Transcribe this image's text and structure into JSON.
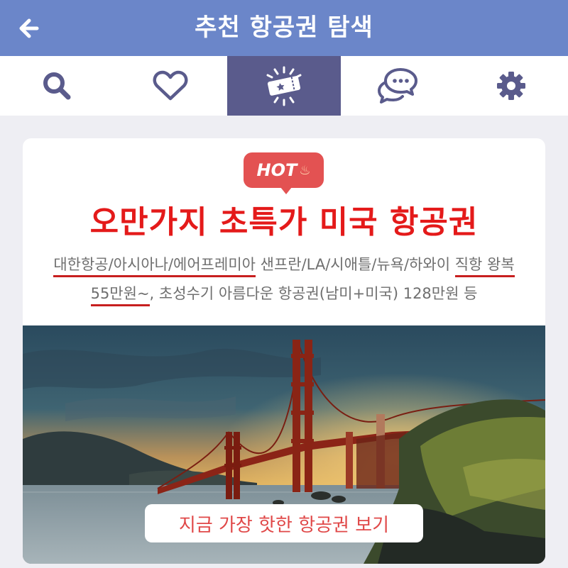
{
  "header": {
    "title": "추천 항공권 탐색",
    "back_icon": "arrow-left-icon"
  },
  "tabs": [
    {
      "icon": "search-icon",
      "active": false
    },
    {
      "icon": "heart-icon",
      "active": false
    },
    {
      "icon": "ticket-icon",
      "active": true
    },
    {
      "icon": "chat-icon",
      "active": false
    },
    {
      "icon": "gear-icon",
      "active": false
    }
  ],
  "card": {
    "badge": "HOT",
    "headline": "오만가지 초특가 미국 항공권",
    "line1": {
      "airlines": "대한항공/아시아나/에어프레미아",
      "cities": " 샌프란/LA/시애틀/뉴욕/하와이 ",
      "direct": "직항 왕복"
    },
    "line2": {
      "price": "55만원~",
      "rest": ", 초성수기 아름다운 항공권(남미+미국) 128만원 등"
    },
    "cta": "지금 가장 핫한 항공권 보기"
  },
  "colors": {
    "header_bg": "#6b86c9",
    "active_tab_bg": "#5a5b8c",
    "icon_color": "#5a5b8c",
    "headline_red": "#e41a1a",
    "badge_red": "#e35252"
  }
}
